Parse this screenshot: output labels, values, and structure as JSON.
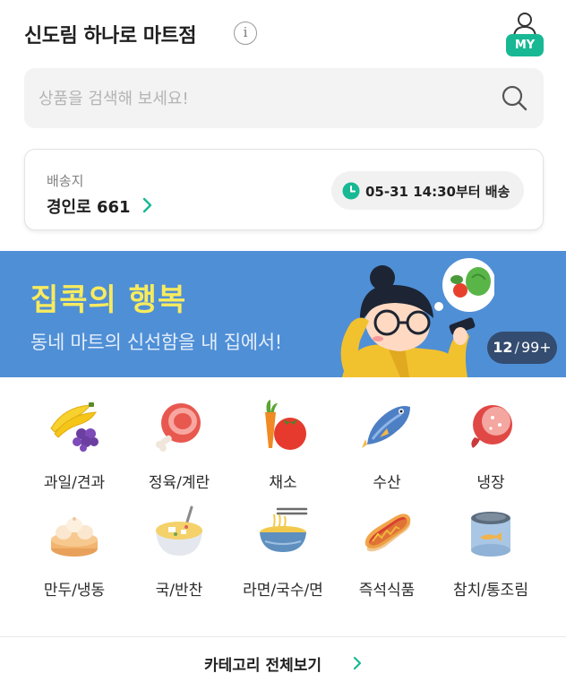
{
  "header": {
    "store_name": "신도림 하나로 마트점",
    "info_icon": "info-icon",
    "my_label": "MY",
    "my_icon": "person-icon",
    "accent_color": "#18b894"
  },
  "search": {
    "placeholder": "상품을 검색해 보세요!",
    "icon": "search-icon"
  },
  "delivery": {
    "label": "배송지",
    "address": "경인로 661",
    "time_text": "05-31 14:30부터 배송",
    "clock_icon": "clock-icon"
  },
  "banner": {
    "title": "집콕의 행복",
    "subtitle": "동네 마트의 신선함을 내 집에서!",
    "current": "12",
    "separator": "/",
    "total": "99+",
    "background_color": "#4f8fd6",
    "title_color": "#f8eb5d"
  },
  "categories": [
    {
      "label": "과일/견과",
      "icon": "fruit-icon"
    },
    {
      "label": "정육/계란",
      "icon": "meat-icon"
    },
    {
      "label": "채소",
      "icon": "vegetable-icon"
    },
    {
      "label": "수산",
      "icon": "fish-icon"
    },
    {
      "label": "냉장",
      "icon": "ham-icon"
    },
    {
      "label": "만두/냉동",
      "icon": "dumpling-icon"
    },
    {
      "label": "국/반찬",
      "icon": "soup-icon"
    },
    {
      "label": "라면/국수/면",
      "icon": "noodle-icon"
    },
    {
      "label": "즉석식품",
      "icon": "hotdog-icon"
    },
    {
      "label": "참치/통조림",
      "icon": "can-icon"
    }
  ],
  "view_all": {
    "label": "카테고리 전체보기",
    "icon": "chevron-right-icon"
  }
}
